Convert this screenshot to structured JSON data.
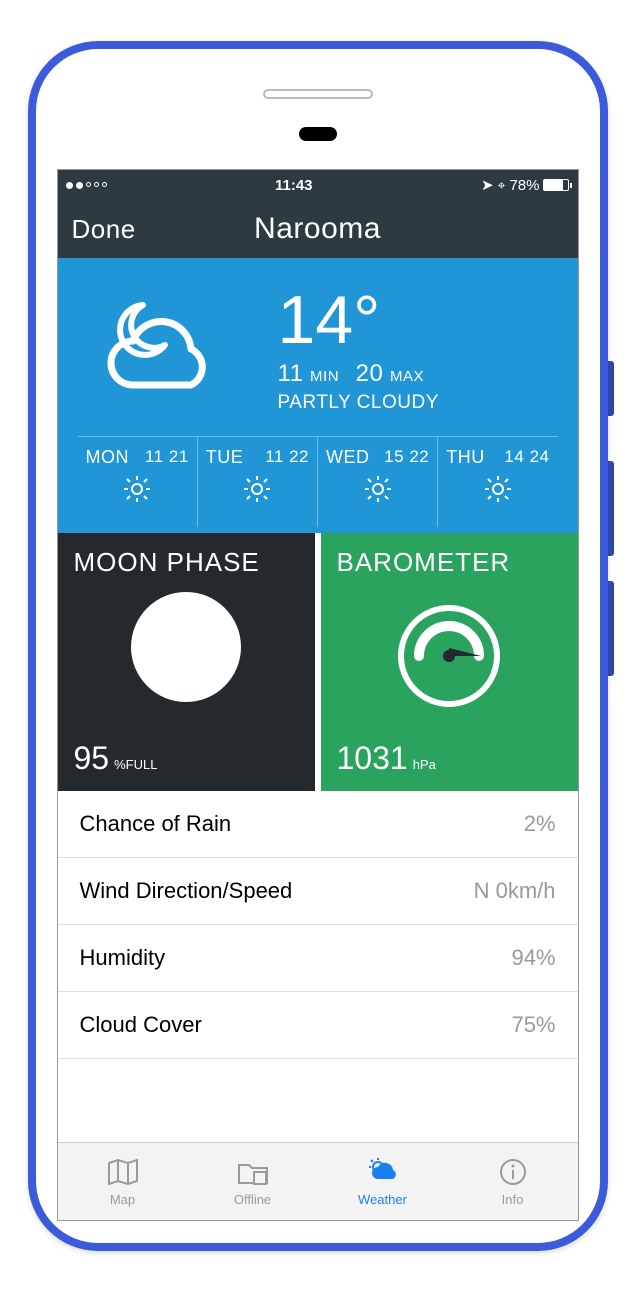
{
  "statusbar": {
    "time": "11:43",
    "battery_pct": "78%",
    "signal_dots_on": 2,
    "signal_dots_total": 5
  },
  "navbar": {
    "done": "Done",
    "title": "Narooma"
  },
  "hero": {
    "temp": "14°",
    "min_val": "11",
    "min_lbl": "MIN",
    "max_val": "20",
    "max_lbl": "MAX",
    "condition": "PARTLY CLOUDY"
  },
  "forecast": [
    {
      "day": "MON",
      "lo": "11",
      "hi": "21",
      "icon": "sun"
    },
    {
      "day": "TUE",
      "lo": "11",
      "hi": "22",
      "icon": "sun"
    },
    {
      "day": "WED",
      "lo": "15",
      "hi": "22",
      "icon": "sun"
    },
    {
      "day": "THU",
      "lo": "14",
      "hi": "24",
      "icon": "sun"
    }
  ],
  "moon": {
    "title": "MOON PHASE",
    "value": "95",
    "unit": "%FULL"
  },
  "barometer": {
    "title": "BAROMETER",
    "value": "1031",
    "unit": "hPa"
  },
  "details": [
    {
      "label": "Chance of Rain",
      "value": "2%"
    },
    {
      "label": "Wind Direction/Speed",
      "value": "N 0km/h"
    },
    {
      "label": "Humidity",
      "value": "94%"
    },
    {
      "label": "Cloud Cover",
      "value": "75%"
    }
  ],
  "tabs": [
    {
      "label": "Map",
      "icon": "map-icon",
      "active": false
    },
    {
      "label": "Offline",
      "icon": "folder-icon",
      "active": false
    },
    {
      "label": "Weather",
      "icon": "weather-icon",
      "active": true
    },
    {
      "label": "Info",
      "icon": "info-icon",
      "active": false
    }
  ],
  "colors": {
    "hero_bg": "#2196d6",
    "navbar_bg": "#2e3a42",
    "moon_bg": "#23292d",
    "baro_bg": "#2aa35f",
    "tab_active": "#1b7ff0"
  }
}
